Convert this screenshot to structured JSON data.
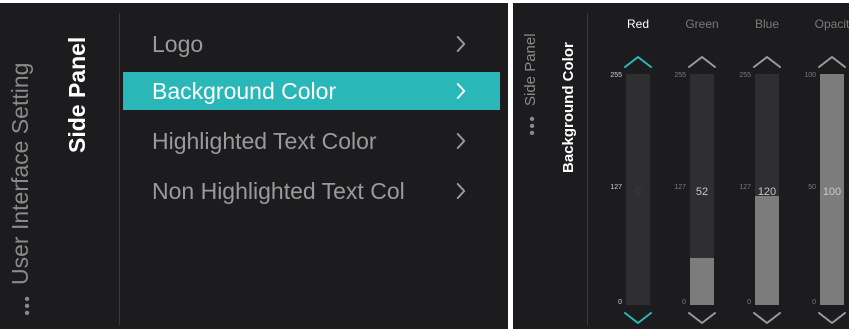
{
  "left_panel": {
    "breadcrumb_parent": "User Interface Setting",
    "breadcrumb_current": "Side Panel",
    "menu": [
      {
        "label": "Logo",
        "selected": false
      },
      {
        "label": "Background Color",
        "selected": true
      },
      {
        "label": "Highlighted Text Color",
        "selected": false
      },
      {
        "label": "Non Highlighted Text Col",
        "selected": false
      }
    ]
  },
  "right_panel": {
    "breadcrumb_parent": "Side Panel",
    "breadcrumb_current": "Background Color",
    "sliders": [
      {
        "label": "Red",
        "value": 0,
        "value_text": "0",
        "max": 255,
        "scale": [
          "255",
          "127",
          "0"
        ],
        "active": true
      },
      {
        "label": "Green",
        "value": 52,
        "value_text": "52",
        "max": 255,
        "scale": [
          "255",
          "127",
          "0"
        ],
        "active": false
      },
      {
        "label": "Blue",
        "value": 120,
        "value_text": "120",
        "max": 255,
        "scale": [
          "255",
          "127",
          "0"
        ],
        "active": false
      },
      {
        "label": "Opacit",
        "value": 100,
        "value_text": "100",
        "max": 100,
        "scale": [
          "100",
          "50",
          "0"
        ],
        "active": false
      }
    ]
  },
  "colors": {
    "accent": "#2ab7b7",
    "panel_bg": "#1c1c1e",
    "track": "#2f2f31",
    "fill": "#7c7c7c"
  },
  "icons": {
    "more": "more-dots-icon",
    "chevron": "chevron-right-icon",
    "up": "chevron-up-icon",
    "down": "chevron-down-icon"
  }
}
